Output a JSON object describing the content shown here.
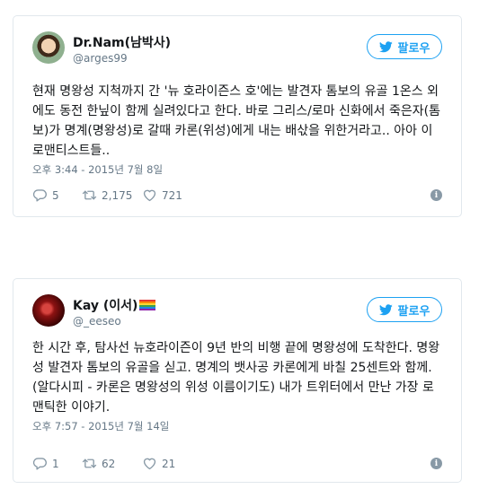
{
  "tweets": [
    {
      "name": "Dr.Nam(남박사)",
      "handle": "@arges99",
      "follow_label": "팔로우",
      "text": "현재 명왕성 지척까지 간 '뉴 호라이즌스 호'에는 발견자 톰보의 유골 1온스 외에도 동전 한닢이 함께 실려있다고 한다. 바로 그리스/로마 신화에서 죽은자(톰보)가 명계(명왕성)로 갈때 카론(위성)에게 내는 배삯을 위한거라고.. 아아 이 로맨티스트들..",
      "timestamp": "오후 3:44 - 2015년 7월 8일",
      "replies": "5",
      "retweets": "2,175",
      "likes": "721"
    },
    {
      "name": "Kay (이서)",
      "handle": "@_eeseo",
      "follow_label": "팔로우",
      "text": "한 시간 후, 탐사선 뉴호라이즌이 9년 반의 비행 끝에 명왕성에 도착한다. 명왕성 발견자 톰보의 유골을 싣고. 명계의 뱃사공 카론에게 바칠 25센트와 함께. (알다시피 - 카론은 명왕성의 위성 이름이기도) 내가 트위터에서 만난 가장 로맨틱한 이야기.",
      "timestamp": "오후 7:57 - 2015년 7월 14일",
      "replies": "1",
      "retweets": "62",
      "likes": "21"
    }
  ],
  "icons": {
    "follow": "twitter-bird-icon",
    "reply": "reply-icon",
    "retweet": "retweet-icon",
    "like": "heart-icon",
    "info": "info-icon"
  },
  "colors": {
    "accent": "#1da1f2",
    "muted": "#657786",
    "border": "#e1e8ed"
  }
}
